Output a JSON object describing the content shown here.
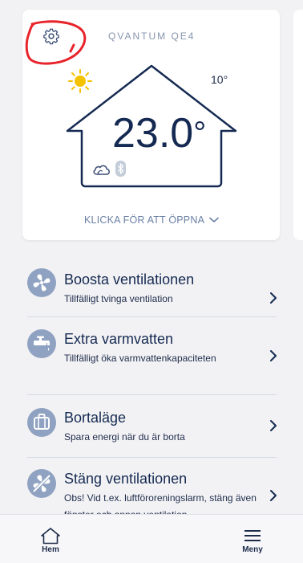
{
  "device": {
    "name": "QVANTUM QE4",
    "outdoor_temp": "10°",
    "indoor_temp": "23.0",
    "indoor_unit": "°",
    "open_label": "KLICKA FÖR ATT ÖPPNA",
    "icons": [
      "gear-icon",
      "sun-icon",
      "house-outline",
      "cloud-icon",
      "bluetooth-icon",
      "chevron-down-icon"
    ]
  },
  "actions": [
    {
      "title": "Boosta ventilationen",
      "sub": "Tillfälligt tvinga ventilation",
      "icon": "fan-icon"
    },
    {
      "title": "Extra varmvatten",
      "sub": "Tillfälligt öka varmvattenkapaciteten",
      "icon": "tap-icon"
    },
    {
      "title": "Bortaläge",
      "sub": "Spara energi när du är borta",
      "icon": "suitcase-icon"
    },
    {
      "title": "Stäng ventilationen",
      "sub": "Obs! Vid t.ex. luftföroreningslarm, stäng även fönster och annan ventilation",
      "icon": "fan-off-icon"
    }
  ],
  "nav": {
    "home_label": "Hem",
    "menu_label": "Meny"
  },
  "colors": {
    "background": "#f2f2f4",
    "card": "#ffffff",
    "navy": "#152a52",
    "icon_circle": "#8fa2c1",
    "link": "#6b80a6",
    "sun": "#f5c200",
    "annotation": "#e8242b"
  }
}
